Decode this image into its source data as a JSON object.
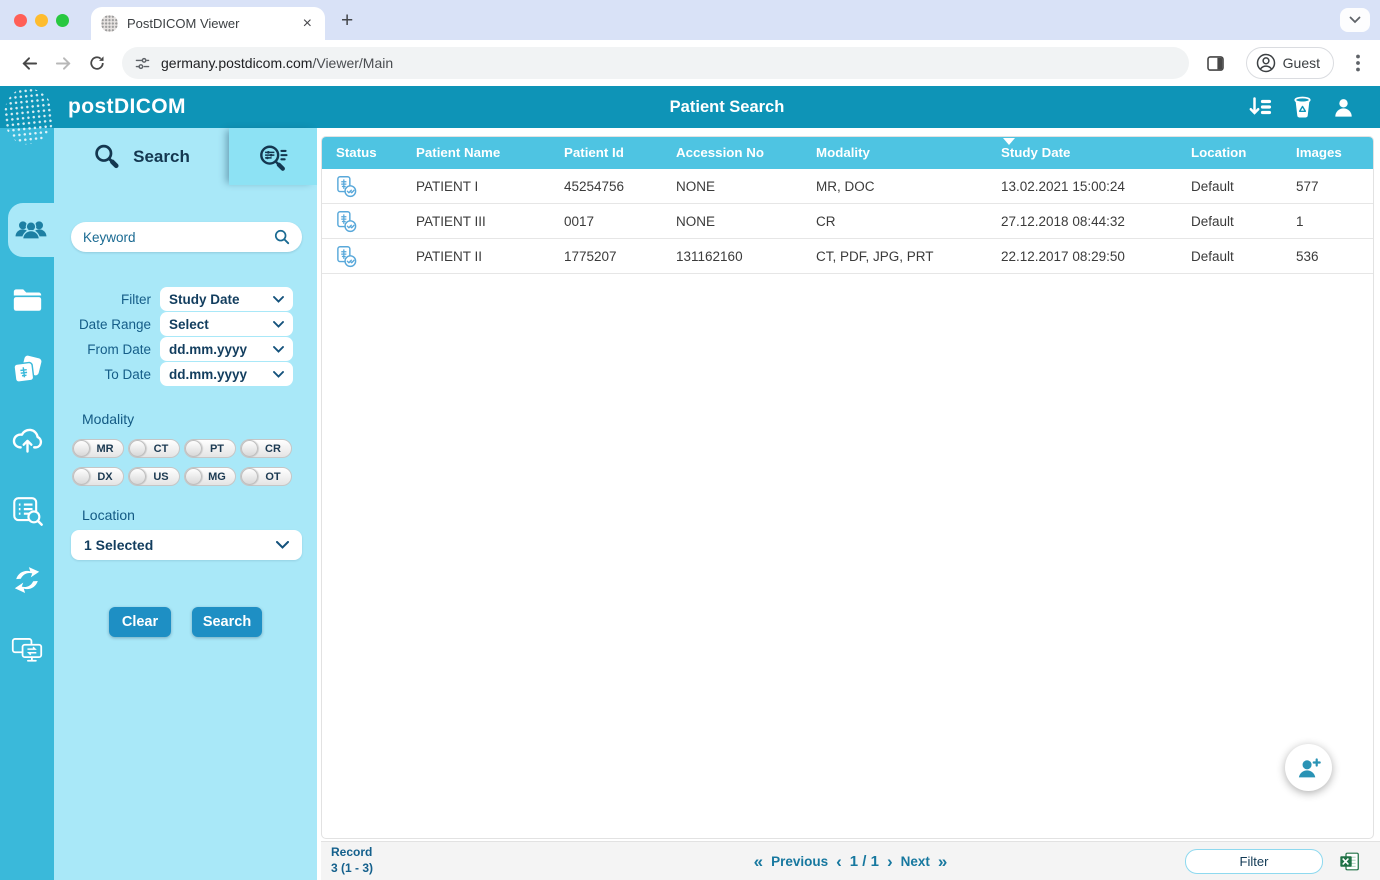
{
  "browser": {
    "tab_title": "PostDICOM Viewer",
    "url_domain": "germany.postdicom.com",
    "url_path": "/Viewer/Main",
    "profile_label": "Guest"
  },
  "glyphs": {
    "close_tab": "×",
    "new_tab": "+",
    "first": "«",
    "prev": "‹",
    "next": "›",
    "last": "»"
  },
  "header": {
    "brand_post": "post",
    "brand_dicom": "DICOM",
    "title": "Patient Search"
  },
  "sidebar_items": [
    "patients",
    "folders",
    "dicom-images",
    "cloud-upload",
    "order-search",
    "sync",
    "share-screens"
  ],
  "search_panel": {
    "tab_label": "Search",
    "keyword_placeholder": "Keyword",
    "filter_rows": [
      {
        "label": "Filter",
        "value": "Study Date"
      },
      {
        "label": "Date Range",
        "value": "Select"
      },
      {
        "label": "From Date",
        "value": "dd.mm.yyyy"
      },
      {
        "label": "To Date",
        "value": "dd.mm.yyyy"
      }
    ],
    "modality_label": "Modality",
    "modalities": [
      "MR",
      "CT",
      "PT",
      "CR",
      "DX",
      "US",
      "MG",
      "OT"
    ],
    "location_label": "Location",
    "location_value": "1 Selected",
    "clear_button": "Clear",
    "search_button": "Search"
  },
  "table": {
    "columns": [
      "Status",
      "Patient Name",
      "Patient Id",
      "Accession No",
      "Modality",
      "Study Date",
      "Location",
      "Images"
    ],
    "sorted_column": "Study Date",
    "sort_direction": "desc",
    "rows": [
      {
        "patient_name": "PATIENT I",
        "patient_id": "45254756",
        "accession_no": "NONE",
        "modality": "MR, DOC",
        "study_date": "13.02.2021 15:00:24",
        "location": "Default",
        "images": "577"
      },
      {
        "patient_name": "PATIENT III",
        "patient_id": "0017",
        "accession_no": "NONE",
        "modality": "CR",
        "study_date": "27.12.2018 08:44:32",
        "location": "Default",
        "images": "1"
      },
      {
        "patient_name": "PATIENT II",
        "patient_id": "1775207",
        "accession_no": "131162160",
        "modality": "CT, PDF, JPG, PRT",
        "study_date": "22.12.2017 08:29:50",
        "location": "Default",
        "images": "536"
      }
    ]
  },
  "footer": {
    "record_label": "Record",
    "record_range": "3 (1 - 3)",
    "previous": "Previous",
    "page": "1 / 1",
    "next": "Next",
    "filter_button": "Filter"
  },
  "colors": {
    "header_teal": "#0e94b7",
    "sidebar_blue": "#3ab9da",
    "panel_cyan": "#a9e8f8",
    "adv_tab_cyan": "#8de2f4",
    "table_header_blue": "#4ec4e2",
    "action_button_blue": "#1e8fc4",
    "dark_navy": "#143750",
    "pagination_teal": "#17789f",
    "status_icon_blue": "#58a8da",
    "excel_green": "#1e7145"
  }
}
